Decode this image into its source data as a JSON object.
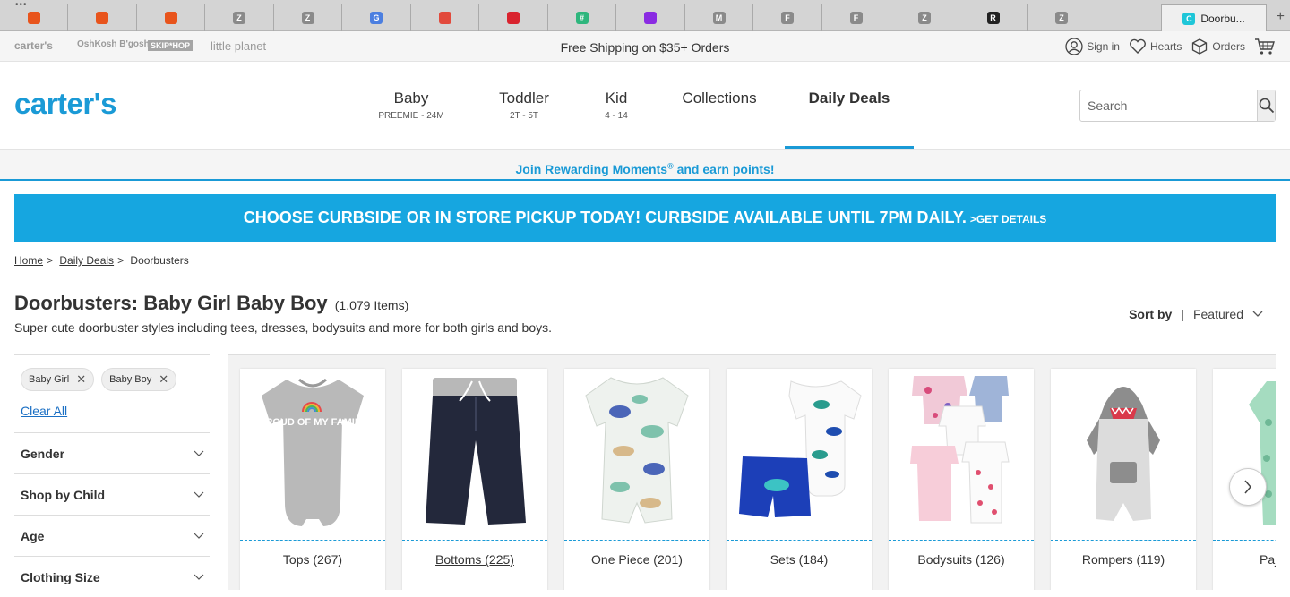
{
  "browser": {
    "active_tab_title": "Doorbu...",
    "favicons": [
      {
        "label": "",
        "color": "#e8541c"
      },
      {
        "label": "",
        "color": "#e8541c"
      },
      {
        "label": "",
        "color": "#e8541c"
      },
      {
        "label": "Z",
        "color": "#8a8a8a"
      },
      {
        "label": "Z",
        "color": "#8a8a8a"
      },
      {
        "label": "G",
        "color": "#4c7fe0"
      },
      {
        "label": "",
        "color": "#e24a3c"
      },
      {
        "label": "",
        "color": "#d9232e"
      },
      {
        "label": "#",
        "color": "#2eb67d"
      },
      {
        "label": "",
        "color": "#8a2be2"
      },
      {
        "label": "M",
        "color": "#8a8a8a"
      },
      {
        "label": "F",
        "color": "#8a8a8a"
      },
      {
        "label": "F",
        "color": "#8a8a8a"
      },
      {
        "label": "Z",
        "color": "#8a8a8a"
      },
      {
        "label": "R",
        "color": "#222222"
      },
      {
        "label": "Z",
        "color": "#8a8a8a"
      },
      {
        "label": "C",
        "color": "#1ec6d8"
      }
    ],
    "active_favicon": {
      "label": "C",
      "color": "#1ec6d8"
    }
  },
  "utility": {
    "brands": [
      "carter's",
      "OshKosh B'gosh",
      "SKIP*HOP",
      "little planet"
    ],
    "shipping": "Free Shipping on $35+ Orders",
    "sign_in": "Sign in",
    "hearts": "Hearts",
    "orders": "Orders"
  },
  "header": {
    "logo": "carter's",
    "nav": [
      {
        "label": "Baby",
        "sub": "PREEMIE - 24M"
      },
      {
        "label": "Toddler",
        "sub": "2T - 5T"
      },
      {
        "label": "Kid",
        "sub": "4 - 14"
      },
      {
        "label": "Collections",
        "sub": ""
      },
      {
        "label": "Daily Deals",
        "sub": ""
      }
    ],
    "search_placeholder": "Search"
  },
  "rewards": {
    "text": "Join Rewarding Moments",
    "mark": "®",
    "tail": " and earn points!"
  },
  "banner": {
    "main": "CHOOSE CURBSIDE OR IN STORE PICKUP TODAY! CURBSIDE AVAILABLE UNTIL 7PM DAILY.",
    "link": ">GET DETAILS"
  },
  "breadcrumb": [
    {
      "label": "Home"
    },
    {
      "label": "Daily Deals"
    },
    {
      "label": "Doorbusters"
    }
  ],
  "page": {
    "title": "Doorbusters: Baby Girl Baby Boy",
    "count": "(1,079 Items)",
    "description": "Super cute doorbuster styles including tees, dresses, bodysuits and more for both girls and boys."
  },
  "sort": {
    "label": "Sort by",
    "value": "Featured"
  },
  "filters": {
    "chips": [
      "Baby Girl",
      "Baby Boy"
    ],
    "clear_all": "Clear All",
    "facets": [
      "Gender",
      "Shop by Child",
      "Age",
      "Clothing Size"
    ]
  },
  "categories": [
    {
      "label": "Tops (267)"
    },
    {
      "label": "Bottoms (225)"
    },
    {
      "label": "One Piece (201)"
    },
    {
      "label": "Sets (184)"
    },
    {
      "label": "Bodysuits (126)"
    },
    {
      "label": "Rompers (119)"
    },
    {
      "label": "Pajamas"
    }
  ],
  "images": {
    "tee_print": "PROUD OF MY FAMILY"
  },
  "colors": {
    "brand_blue": "#1a9ad6",
    "banner_blue": "#16a6e0",
    "link_blue": "#1a6fc4"
  }
}
